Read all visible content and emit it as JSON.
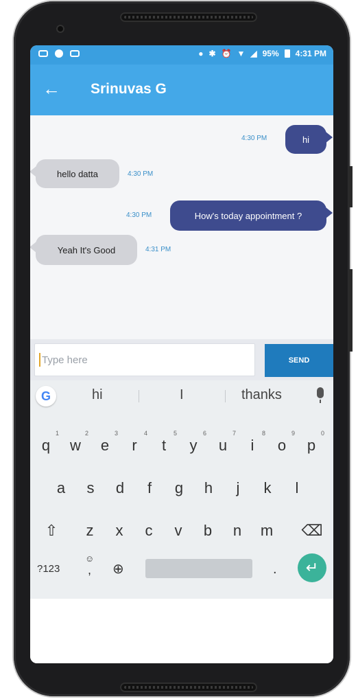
{
  "status": {
    "battery": "95%",
    "time": "4:31 PM"
  },
  "header": {
    "title": "Srinuvas G"
  },
  "messages": [
    {
      "text": "hi",
      "time": "4:30 PM",
      "direction": "sent"
    },
    {
      "text": "hello datta",
      "time": "4:30 PM",
      "direction": "received"
    },
    {
      "text": "How's today appointment ?",
      "time": "4:30 PM",
      "direction": "sent"
    },
    {
      "text": "Yeah It's Good",
      "time": "4:31 PM",
      "direction": "received"
    }
  ],
  "composer": {
    "placeholder": "Type here",
    "send_label": "SEND"
  },
  "keyboard": {
    "suggestions": [
      "hi",
      "I",
      "thanks"
    ],
    "row1": [
      "q",
      "w",
      "e",
      "r",
      "t",
      "y",
      "u",
      "i",
      "o",
      "p"
    ],
    "row1_hints": [
      "1",
      "2",
      "3",
      "4",
      "5",
      "6",
      "7",
      "8",
      "9",
      "0"
    ],
    "row2": [
      "a",
      "s",
      "d",
      "f",
      "g",
      "h",
      "j",
      "k",
      "l"
    ],
    "row3": [
      "z",
      "x",
      "c",
      "v",
      "b",
      "n",
      "m"
    ],
    "symbols_label": "?123",
    "comma": ",",
    "period": "."
  },
  "colors": {
    "app_bar": "#44a8e8",
    "sent_bubble": "#3e4b8e",
    "received_bubble": "#d2d3d8",
    "send_button": "#1f7bbd",
    "enter_key": "#3bb39a"
  }
}
